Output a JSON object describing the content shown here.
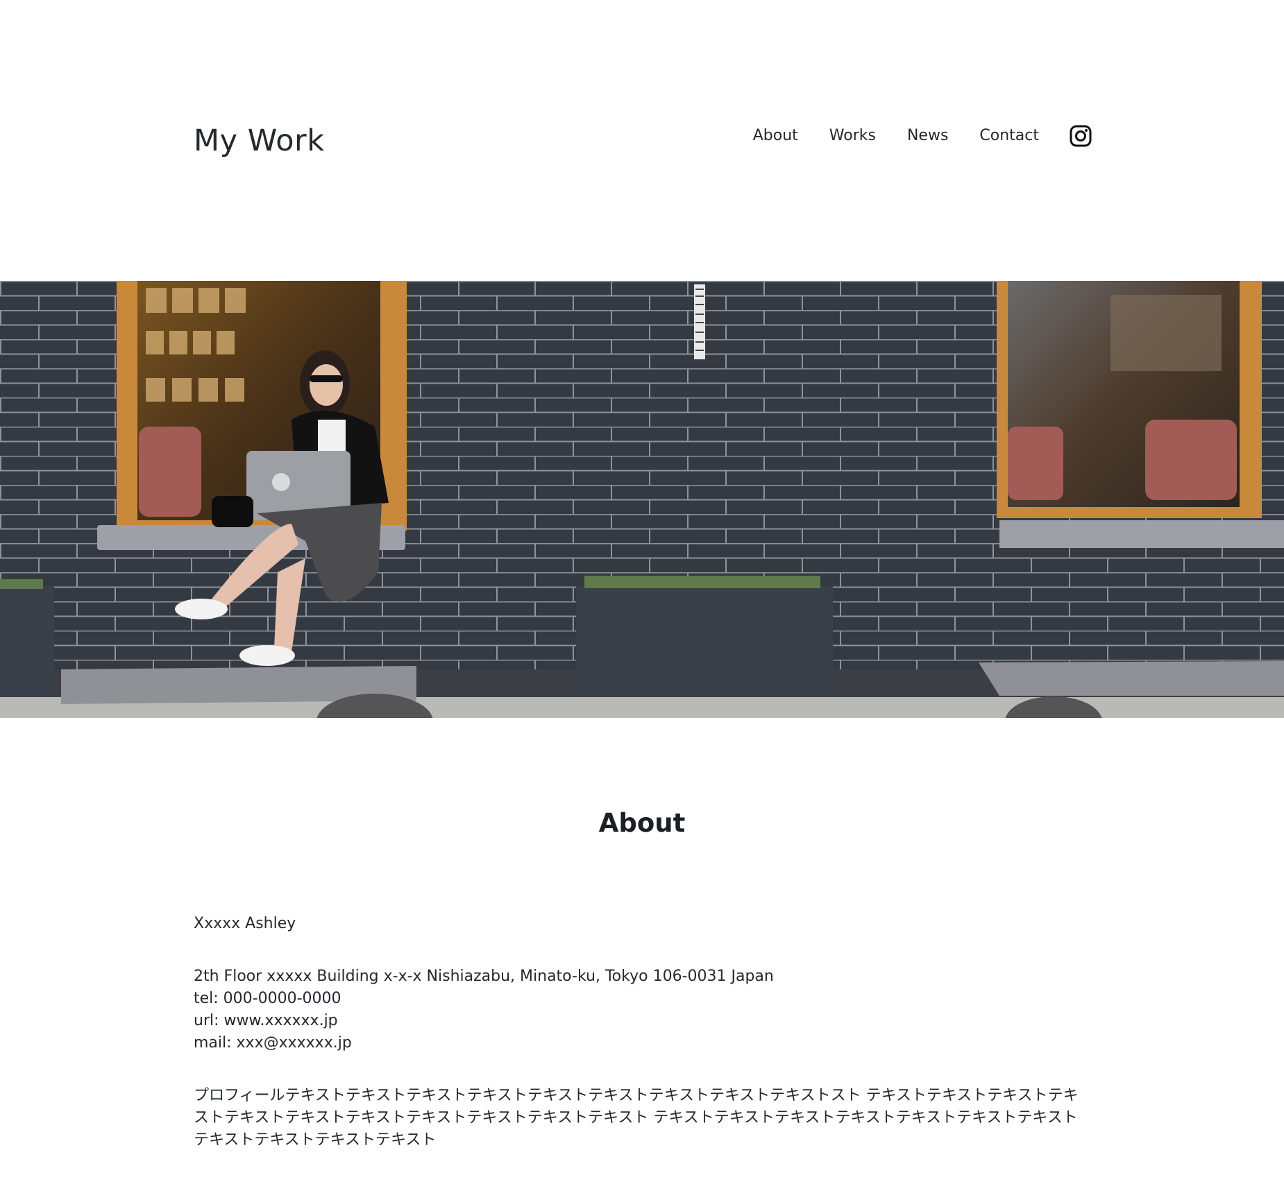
{
  "site": {
    "title": "My Work"
  },
  "nav": {
    "items": [
      {
        "label": "About"
      },
      {
        "label": "Works"
      },
      {
        "label": "News"
      },
      {
        "label": "Contact"
      }
    ],
    "instagram_icon": "instagram-icon"
  },
  "hero": {
    "image_description_icon": "hero-photo"
  },
  "about": {
    "heading": "About",
    "name": "Xxxxx Ashley",
    "address": "2th Floor xxxxx Building x-x-x Nishiazabu, Minato-ku, Tokyo 106-0031 Japan",
    "tel": "tel: 000-0000-0000",
    "url": "url: www.xxxxxx.jp",
    "mail": "mail: xxx@xxxxxx.jp",
    "profile": "プロフィールテキストテキストテキストテキストテキストテキストテキストテキストテキストスト テキストテキストテキストテキストテキストテキストテキストテキストテキストテキストテキスト テキストテキストテキストテキストテキストテキストテキストテキストテキストテキストテキスト"
  },
  "colors": {
    "text": "#24292e",
    "brick": "#353a42",
    "mortar": "#a9adb3",
    "window_frame": "#c88a3a"
  }
}
